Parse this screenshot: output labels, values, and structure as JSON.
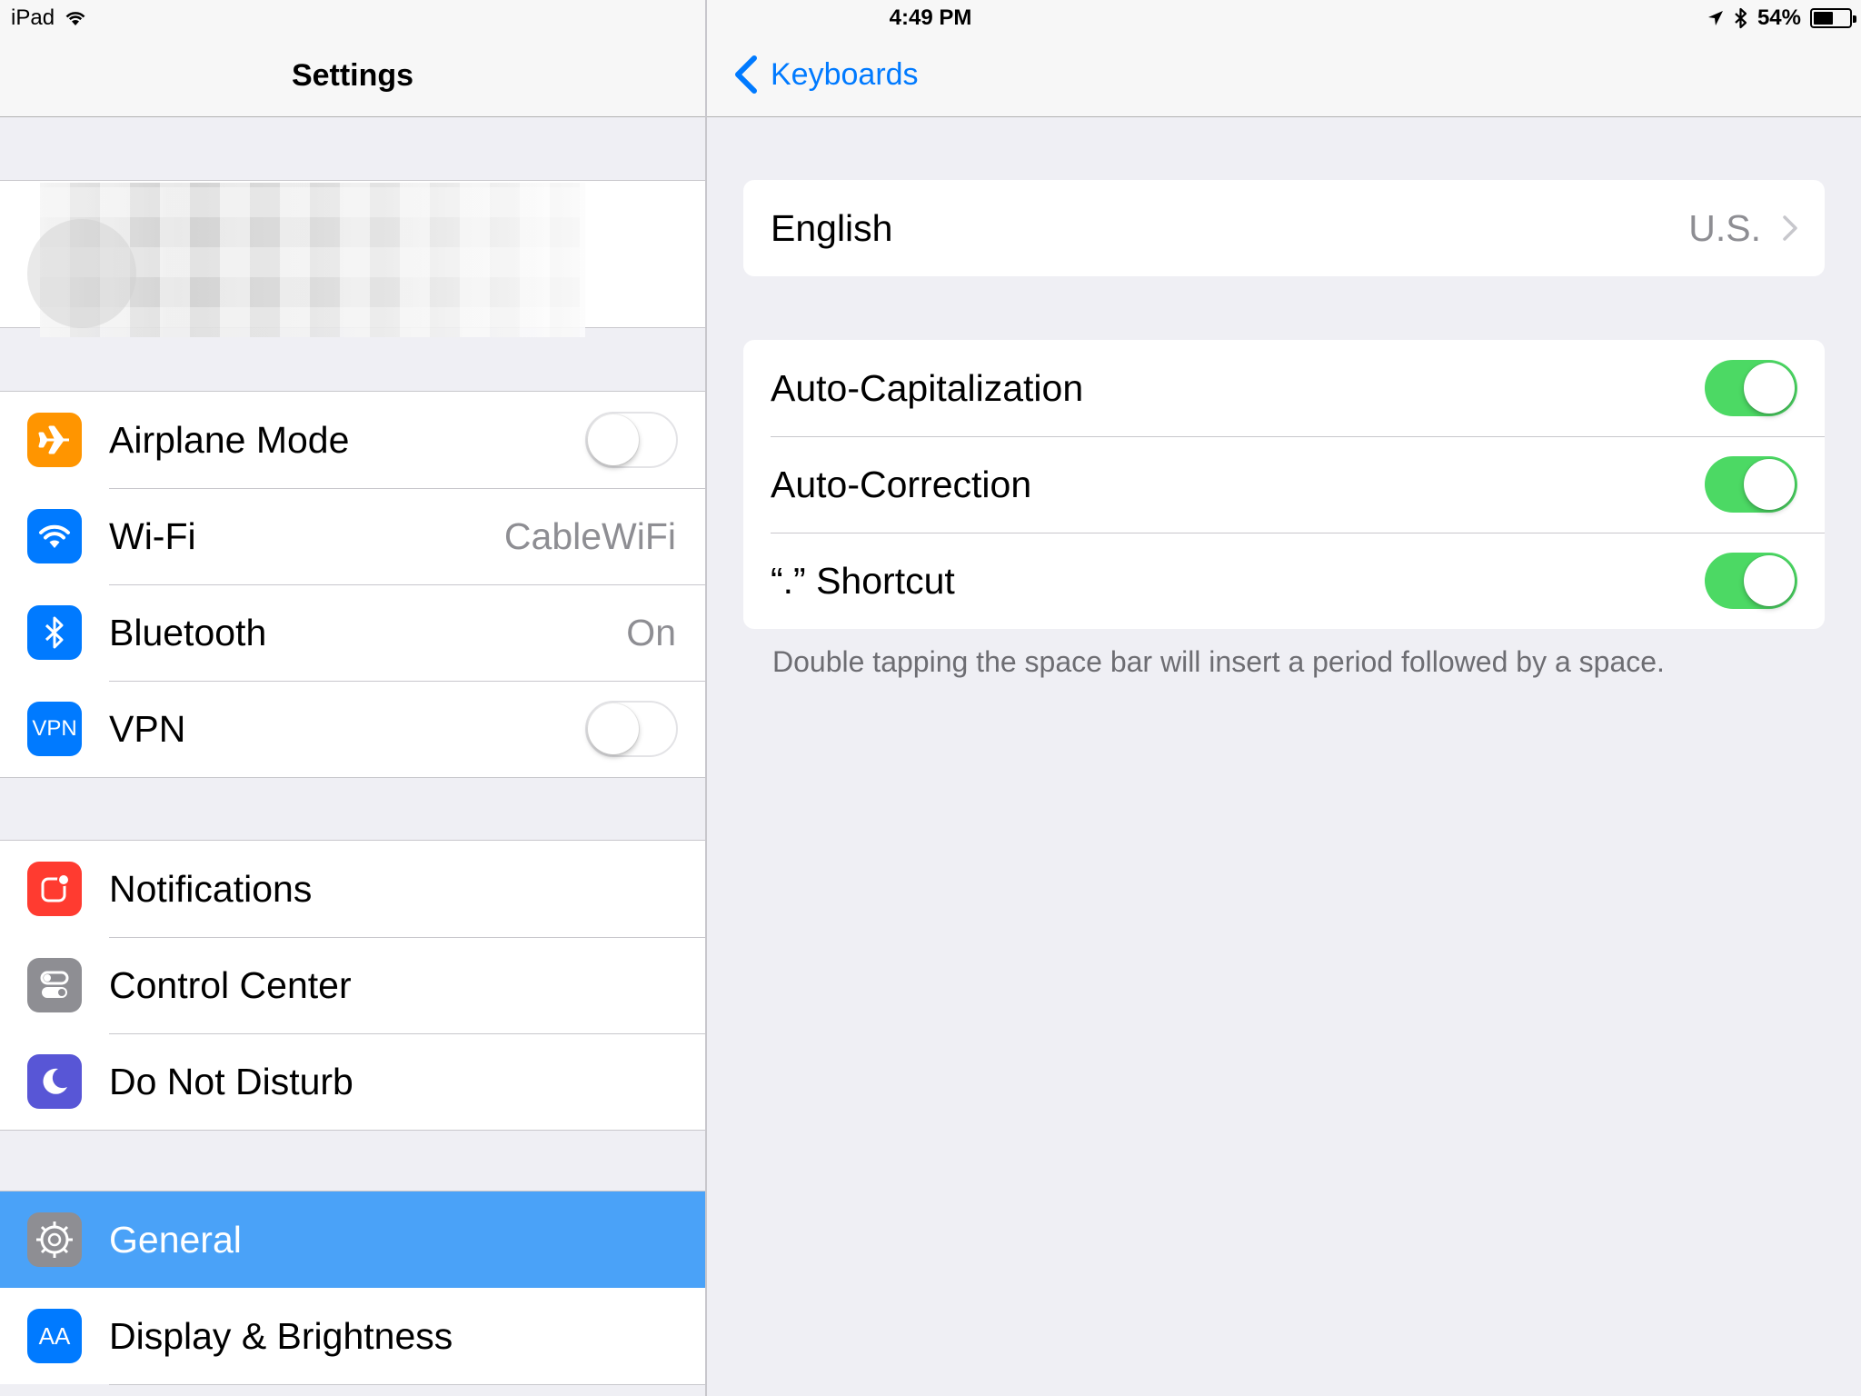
{
  "status_bar": {
    "device": "iPad",
    "time": "4:49 PM",
    "battery_percent": "54%",
    "battery_level": 0.54,
    "icons": [
      "wifi-icon",
      "location-arrow-icon",
      "bluetooth-icon",
      "battery-icon"
    ]
  },
  "master": {
    "title": "Settings",
    "group1": [
      {
        "label": "Airplane Mode",
        "icon": "airplane-icon",
        "color": "#ff9500",
        "toggle": false
      },
      {
        "label": "Wi-Fi",
        "icon": "wifi-icon",
        "color": "#007aff",
        "value": "CableWiFi"
      },
      {
        "label": "Bluetooth",
        "icon": "bluetooth-icon",
        "color": "#007aff",
        "value": "On"
      },
      {
        "label": "VPN",
        "icon": "vpn-icon",
        "color": "#007aff",
        "icon_text": "VPN",
        "toggle": false
      }
    ],
    "group2": [
      {
        "label": "Notifications",
        "icon": "notifications-icon",
        "color": "#ff3b30"
      },
      {
        "label": "Control Center",
        "icon": "control-center-icon",
        "color": "#8e8e93"
      },
      {
        "label": "Do Not Disturb",
        "icon": "moon-icon",
        "color": "#5856d6"
      }
    ],
    "group3": [
      {
        "label": "General",
        "icon": "gear-icon",
        "color": "#8e8e93",
        "selected": true
      },
      {
        "label": "Display & Brightness",
        "icon": "display-brightness-icon",
        "color": "#007aff",
        "icon_text": "AA"
      }
    ]
  },
  "detail": {
    "back_label": "Keyboards",
    "language": {
      "label": "English",
      "value": "U.S."
    },
    "toggles": [
      {
        "label": "Auto-Capitalization",
        "on": true
      },
      {
        "label": "Auto-Correction",
        "on": true
      },
      {
        "label": "“.” Shortcut",
        "on": true
      }
    ],
    "footnote": "Double tapping the space bar will insert a period followed by a space."
  },
  "colors": {
    "accent": "#007aff",
    "toggle_on": "#4cd964",
    "selected_row": "#4aa2f8"
  }
}
